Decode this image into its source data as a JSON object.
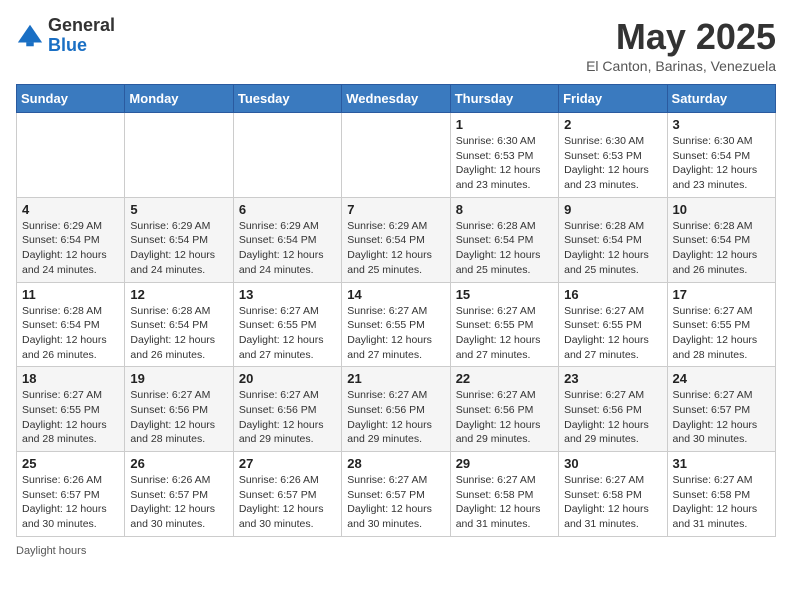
{
  "header": {
    "logo_general": "General",
    "logo_blue": "Blue",
    "month_title": "May 2025",
    "location": "El Canton, Barinas, Venezuela"
  },
  "days_of_week": [
    "Sunday",
    "Monday",
    "Tuesday",
    "Wednesday",
    "Thursday",
    "Friday",
    "Saturday"
  ],
  "weeks": [
    [
      {
        "day": "",
        "info": ""
      },
      {
        "day": "",
        "info": ""
      },
      {
        "day": "",
        "info": ""
      },
      {
        "day": "",
        "info": ""
      },
      {
        "day": "1",
        "info": "Sunrise: 6:30 AM\nSunset: 6:53 PM\nDaylight: 12 hours\nand 23 minutes."
      },
      {
        "day": "2",
        "info": "Sunrise: 6:30 AM\nSunset: 6:53 PM\nDaylight: 12 hours\nand 23 minutes."
      },
      {
        "day": "3",
        "info": "Sunrise: 6:30 AM\nSunset: 6:54 PM\nDaylight: 12 hours\nand 23 minutes."
      }
    ],
    [
      {
        "day": "4",
        "info": "Sunrise: 6:29 AM\nSunset: 6:54 PM\nDaylight: 12 hours\nand 24 minutes."
      },
      {
        "day": "5",
        "info": "Sunrise: 6:29 AM\nSunset: 6:54 PM\nDaylight: 12 hours\nand 24 minutes."
      },
      {
        "day": "6",
        "info": "Sunrise: 6:29 AM\nSunset: 6:54 PM\nDaylight: 12 hours\nand 24 minutes."
      },
      {
        "day": "7",
        "info": "Sunrise: 6:29 AM\nSunset: 6:54 PM\nDaylight: 12 hours\nand 25 minutes."
      },
      {
        "day": "8",
        "info": "Sunrise: 6:28 AM\nSunset: 6:54 PM\nDaylight: 12 hours\nand 25 minutes."
      },
      {
        "day": "9",
        "info": "Sunrise: 6:28 AM\nSunset: 6:54 PM\nDaylight: 12 hours\nand 25 minutes."
      },
      {
        "day": "10",
        "info": "Sunrise: 6:28 AM\nSunset: 6:54 PM\nDaylight: 12 hours\nand 26 minutes."
      }
    ],
    [
      {
        "day": "11",
        "info": "Sunrise: 6:28 AM\nSunset: 6:54 PM\nDaylight: 12 hours\nand 26 minutes."
      },
      {
        "day": "12",
        "info": "Sunrise: 6:28 AM\nSunset: 6:54 PM\nDaylight: 12 hours\nand 26 minutes."
      },
      {
        "day": "13",
        "info": "Sunrise: 6:27 AM\nSunset: 6:55 PM\nDaylight: 12 hours\nand 27 minutes."
      },
      {
        "day": "14",
        "info": "Sunrise: 6:27 AM\nSunset: 6:55 PM\nDaylight: 12 hours\nand 27 minutes."
      },
      {
        "day": "15",
        "info": "Sunrise: 6:27 AM\nSunset: 6:55 PM\nDaylight: 12 hours\nand 27 minutes."
      },
      {
        "day": "16",
        "info": "Sunrise: 6:27 AM\nSunset: 6:55 PM\nDaylight: 12 hours\nand 27 minutes."
      },
      {
        "day": "17",
        "info": "Sunrise: 6:27 AM\nSunset: 6:55 PM\nDaylight: 12 hours\nand 28 minutes."
      }
    ],
    [
      {
        "day": "18",
        "info": "Sunrise: 6:27 AM\nSunset: 6:55 PM\nDaylight: 12 hours\nand 28 minutes."
      },
      {
        "day": "19",
        "info": "Sunrise: 6:27 AM\nSunset: 6:56 PM\nDaylight: 12 hours\nand 28 minutes."
      },
      {
        "day": "20",
        "info": "Sunrise: 6:27 AM\nSunset: 6:56 PM\nDaylight: 12 hours\nand 29 minutes."
      },
      {
        "day": "21",
        "info": "Sunrise: 6:27 AM\nSunset: 6:56 PM\nDaylight: 12 hours\nand 29 minutes."
      },
      {
        "day": "22",
        "info": "Sunrise: 6:27 AM\nSunset: 6:56 PM\nDaylight: 12 hours\nand 29 minutes."
      },
      {
        "day": "23",
        "info": "Sunrise: 6:27 AM\nSunset: 6:56 PM\nDaylight: 12 hours\nand 29 minutes."
      },
      {
        "day": "24",
        "info": "Sunrise: 6:27 AM\nSunset: 6:57 PM\nDaylight: 12 hours\nand 30 minutes."
      }
    ],
    [
      {
        "day": "25",
        "info": "Sunrise: 6:26 AM\nSunset: 6:57 PM\nDaylight: 12 hours\nand 30 minutes."
      },
      {
        "day": "26",
        "info": "Sunrise: 6:26 AM\nSunset: 6:57 PM\nDaylight: 12 hours\nand 30 minutes."
      },
      {
        "day": "27",
        "info": "Sunrise: 6:26 AM\nSunset: 6:57 PM\nDaylight: 12 hours\nand 30 minutes."
      },
      {
        "day": "28",
        "info": "Sunrise: 6:27 AM\nSunset: 6:57 PM\nDaylight: 12 hours\nand 30 minutes."
      },
      {
        "day": "29",
        "info": "Sunrise: 6:27 AM\nSunset: 6:58 PM\nDaylight: 12 hours\nand 31 minutes."
      },
      {
        "day": "30",
        "info": "Sunrise: 6:27 AM\nSunset: 6:58 PM\nDaylight: 12 hours\nand 31 minutes."
      },
      {
        "day": "31",
        "info": "Sunrise: 6:27 AM\nSunset: 6:58 PM\nDaylight: 12 hours\nand 31 minutes."
      }
    ]
  ],
  "footer": {
    "daylight_hours_label": "Daylight hours"
  }
}
